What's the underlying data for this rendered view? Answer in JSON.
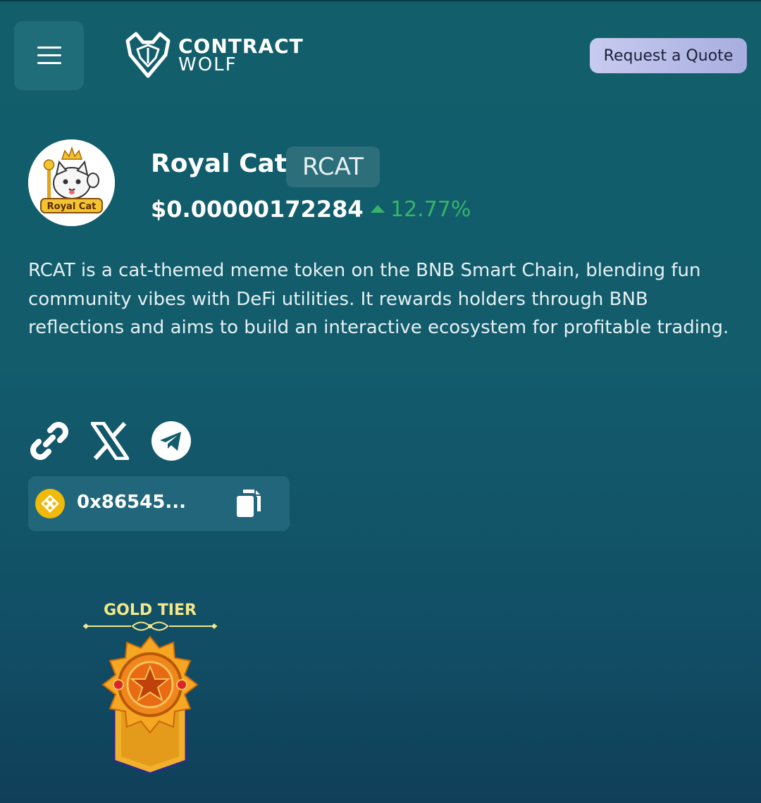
{
  "header": {
    "menu_icon": "hamburger-menu-icon",
    "logo_line1": "CONTRACT",
    "logo_line2": "WOLF",
    "quote_button": "Request a Quote"
  },
  "token": {
    "avatar_text": "Royal Cat",
    "name": "Royal Cat",
    "ticker": "RCAT",
    "price": "$0.00000172284",
    "change": "12.77%",
    "change_direction": "up",
    "change_color": "#36b56a",
    "description": "RCAT is a cat-themed meme token on the BNB Smart Chain, blending fun community vibes with DeFi utilities. It rewards holders through BNB reflections and aims to build an interactive ecosystem for profitable trading."
  },
  "social": {
    "icons": [
      "link-icon",
      "x-icon",
      "telegram-icon"
    ]
  },
  "contract": {
    "chain_icon": "bnb-icon",
    "address": "0x86545...",
    "copy_icon": "copy-icon"
  },
  "tier": {
    "label": "GOLD TIER",
    "badge_icon": "gold-tier-badge-icon"
  }
}
